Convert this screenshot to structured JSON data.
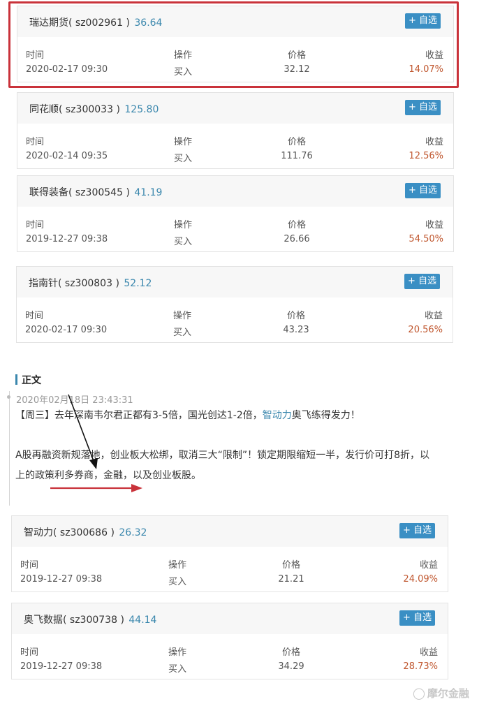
{
  "labels": {
    "time": "时间",
    "op": "操作",
    "price": "价格",
    "gain": "收益"
  },
  "add_button": "+ 自选",
  "stocks_top": [
    {
      "name": "瑞达期货",
      "code": "( sz002961 )",
      "price": "36.64",
      "time": "2020-02-17 09:30",
      "op": "买入",
      "buy_price": "32.12",
      "gain": "14.07%"
    },
    {
      "name": "同花顺",
      "code": "( sz300033 )",
      "price": "125.80",
      "time": "2020-02-14 09:35",
      "op": "买入",
      "buy_price": "111.76",
      "gain": "12.56%"
    },
    {
      "name": "联得装备",
      "code": "( sz300545 )",
      "price": "41.19",
      "time": "2019-12-27 09:38",
      "op": "买入",
      "buy_price": "26.66",
      "gain": "54.50%"
    },
    {
      "name": "指南针",
      "code": "( sz300803 )",
      "price": "52.12",
      "time": "2020-02-17 09:30",
      "op": "买入",
      "buy_price": "43.23",
      "gain": "20.56%"
    }
  ],
  "article": {
    "section_title": "正文",
    "post_time": "2020年02月18日 23:43:31",
    "para1_pre": "【周三】去年深南韦尔君正都有3-5倍，国光创达1-2倍，",
    "para1_link": "智动力",
    "para1_post": "奥飞练得发力！",
    "para2_line1": "A股再融资新规落地，创业板大松绑，取消三大“限制”！锁定期限缩短一半，发行价可打8折，以",
    "para2_line2": "上的政策利多券商，金融，以及创业板股。"
  },
  "stocks_bottom": [
    {
      "name": "智动力",
      "code": "( sz300686 )",
      "price": "26.32",
      "time": "2019-12-27 09:38",
      "op": "买入",
      "buy_price": "21.21",
      "gain": "24.09%"
    },
    {
      "name": "奥飞数据",
      "code": "( sz300738 )",
      "price": "44.14",
      "time": "2019-12-27 09:38",
      "op": "买入",
      "buy_price": "34.29",
      "gain": "28.73%"
    }
  ],
  "watermark": {
    "icon": "wechat-logo-icon",
    "text": "摩尔金融"
  }
}
